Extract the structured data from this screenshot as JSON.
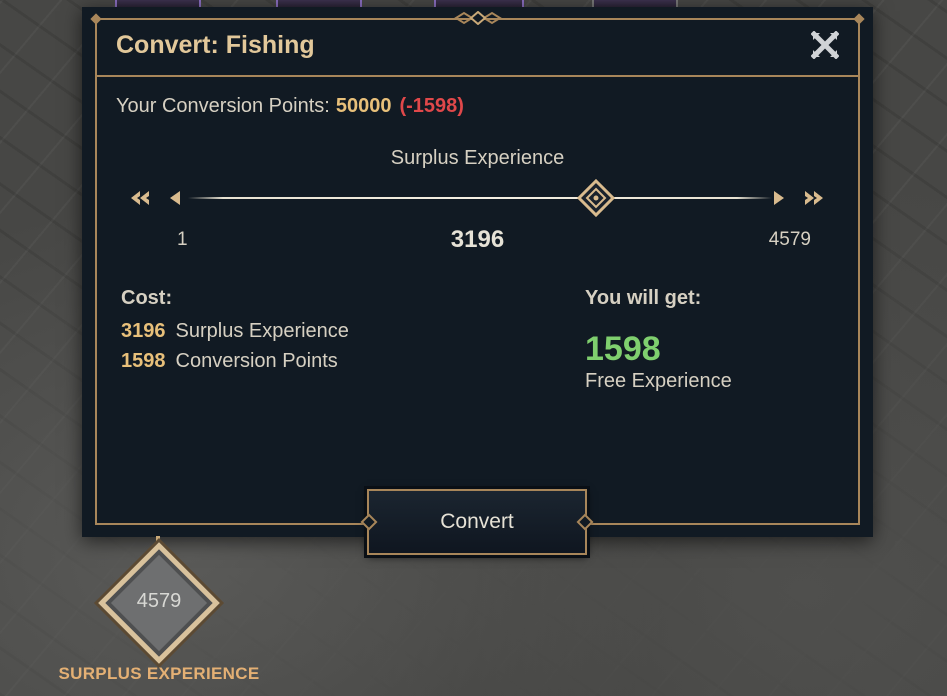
{
  "dialog": {
    "title": "Convert: Fishing",
    "close_icon": "close-x-icon"
  },
  "conversion_points": {
    "label": "Your Conversion Points:",
    "value": "50000",
    "delta": "(-1598)"
  },
  "slider": {
    "title": "Surplus Experience",
    "min_label": "1",
    "max_label": "4579",
    "current_label": "3196",
    "min": 1,
    "max": 4579,
    "value": 3196,
    "icons": {
      "first": "double-chevron-left-icon",
      "prev": "arrow-left-icon",
      "next": "arrow-right-icon",
      "last": "double-chevron-right-icon",
      "thumb": "diamond-thumb-icon"
    }
  },
  "cost": {
    "label": "Cost:",
    "items": [
      {
        "amount": "3196",
        "unit": "Surplus Experience"
      },
      {
        "amount": "1598",
        "unit": "Conversion Points"
      }
    ]
  },
  "reward": {
    "label": "You will get:",
    "amount": "1598",
    "unit": "Free Experience"
  },
  "convert_button": {
    "label": "Convert"
  },
  "badge": {
    "value": "4579",
    "caption": "SURPLUS EXPERIENCE"
  },
  "colors": {
    "panel": "#111a23",
    "gold_border": "#a8865a",
    "title": "#e2c89a",
    "accent_value": "#e8c07a",
    "negative": "#e0484a",
    "positive": "#7fcf6e",
    "caption": "#e4b074"
  }
}
